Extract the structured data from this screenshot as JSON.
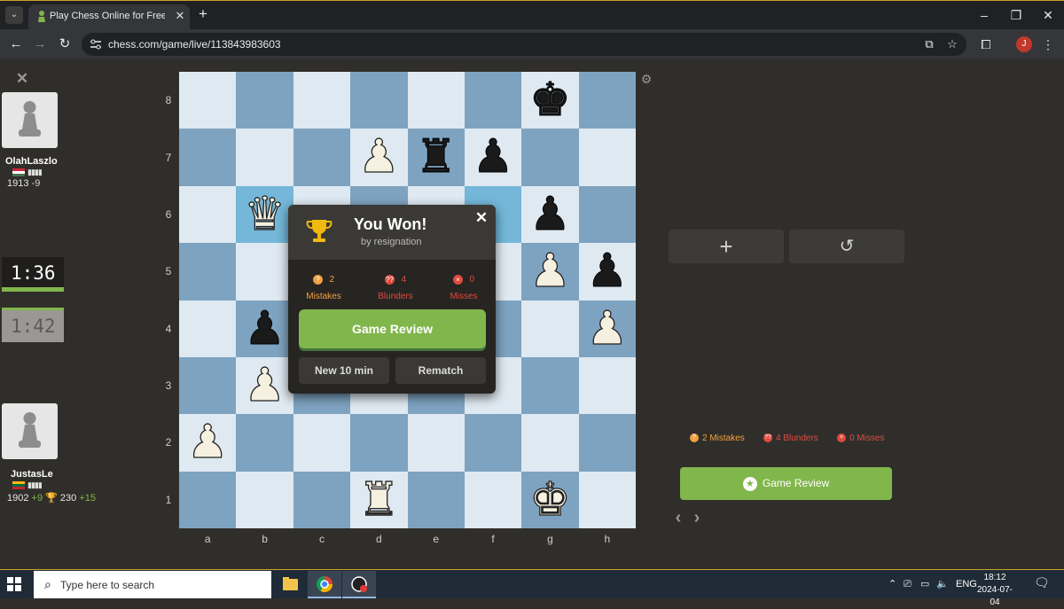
{
  "browser": {
    "tab_title": "Play Chess Online for Free with",
    "url": "chess.com/game/live/113843983603",
    "profile_initial": "J"
  },
  "players": {
    "top": {
      "name": "OlahLaszlo",
      "rating": "1913",
      "delta": "-9",
      "clock": "1:36"
    },
    "bottom": {
      "name": "JustasLe",
      "rating": "1902",
      "delta": "+9",
      "trophy_points": "230",
      "trophy_delta": "+15",
      "clock": "1:42"
    }
  },
  "board": {
    "ranks": [
      "8",
      "7",
      "6",
      "5",
      "4",
      "3",
      "2",
      "1"
    ],
    "files": [
      "a",
      "b",
      "c",
      "d",
      "e",
      "f",
      "g",
      "h"
    ],
    "pieces": [
      {
        "sq": "g8",
        "glyph": "♚",
        "color": "b"
      },
      {
        "sq": "d7",
        "glyph": "♟",
        "color": "w"
      },
      {
        "sq": "e7",
        "glyph": "♜",
        "color": "b"
      },
      {
        "sq": "f7",
        "glyph": "♟",
        "color": "b"
      },
      {
        "sq": "b6",
        "glyph": "♛",
        "color": "w"
      },
      {
        "sq": "g6",
        "glyph": "♟",
        "color": "b"
      },
      {
        "sq": "g5",
        "glyph": "♟",
        "color": "w"
      },
      {
        "sq": "h5",
        "glyph": "♟",
        "color": "b"
      },
      {
        "sq": "b4",
        "glyph": "♟",
        "color": "b"
      },
      {
        "sq": "h4",
        "glyph": "♟",
        "color": "w"
      },
      {
        "sq": "b3",
        "glyph": "♟",
        "color": "w"
      },
      {
        "sq": "a2",
        "glyph": "♟",
        "color": "w"
      },
      {
        "sq": "d1",
        "glyph": "♜",
        "color": "w"
      },
      {
        "sq": "g1",
        "glyph": "♚",
        "color": "w"
      }
    ],
    "highlighted": [
      "b6",
      "f6"
    ]
  },
  "modal": {
    "title": "You Won!",
    "subtitle": "by resignation",
    "stats": [
      {
        "count": "2",
        "label": "Mistakes",
        "icon": "?",
        "color": "#f0a040"
      },
      {
        "count": "4",
        "label": "Blunders",
        "icon": "??",
        "color": "#e04b3f"
      },
      {
        "count": "0",
        "label": "Misses",
        "icon": "×",
        "color": "#e04b3f"
      }
    ],
    "review_label": "Game Review",
    "new_game_label": "New 10 min",
    "rematch_label": "Rematch"
  },
  "sidebar": {
    "summary": [
      {
        "text": "2 Mistakes",
        "icon": "?",
        "color": "#f0a040"
      },
      {
        "text": "4 Blunders",
        "icon": "??",
        "color": "#e04b3f"
      },
      {
        "text": "0 Misses",
        "icon": "×",
        "color": "#e04b3f"
      }
    ],
    "review_label": "Game Review"
  },
  "taskbar": {
    "search_placeholder": "Type here to search",
    "language": "ENG",
    "time": "18:12",
    "date": "2024-07-04"
  },
  "colors": {
    "accent_green": "#81b64c",
    "board_light": "#dfe9f1",
    "board_dark": "#7ea3c1",
    "highlight": "#74b7d8"
  }
}
